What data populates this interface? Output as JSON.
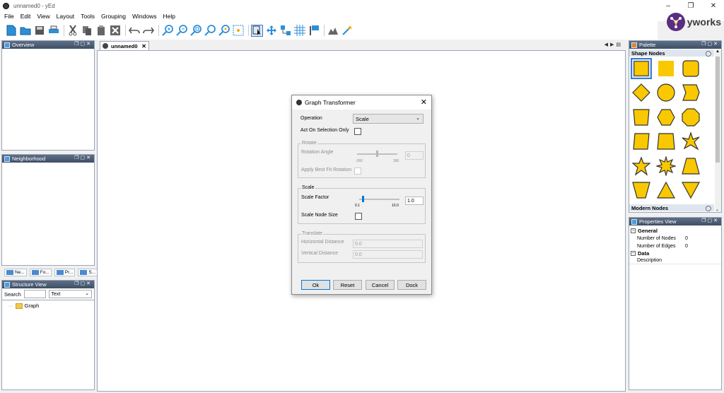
{
  "window": {
    "title": "unnamed0 - yEd"
  },
  "menu": [
    "File",
    "Edit",
    "View",
    "Layout",
    "Tools",
    "Grouping",
    "Windows",
    "Help"
  ],
  "logo": {
    "text": "yworks",
    "color": "#5a2d82"
  },
  "toolbar": {
    "icons": [
      "new-document-icon",
      "open-folder-icon",
      "save-icon",
      "print-icon",
      "cut-icon",
      "copy-icon",
      "paste-icon",
      "delete-icon",
      "undo-icon",
      "redo-icon",
      "zoom-in-icon",
      "zoom-out-icon",
      "zoom-fit-icon",
      "zoom-original-icon",
      "zoom-area-icon",
      "fit-content-icon",
      "edit-mode-icon",
      "move-mode-icon",
      "group-icon",
      "grid-icon",
      "snap-icon",
      "image-icon",
      "magic-wand-icon"
    ],
    "active": "edit-mode-icon"
  },
  "panels": {
    "overview": {
      "title": "Overview"
    },
    "neighborhood": {
      "title": "Neighborhood"
    },
    "bottom_tabs": [
      "Ne...",
      "Fo...",
      "Pr...",
      "S..."
    ],
    "structure": {
      "title": "Structure View",
      "search_label": "Search",
      "search_value": "",
      "filter": "Text",
      "tree": [
        "Graph"
      ]
    },
    "palette": {
      "title": "Palette",
      "section": "Shape Nodes",
      "section2": "Modern Nodes",
      "fill_color": "#f9c800",
      "stroke_color": "#333333"
    },
    "properties": {
      "title": "Properties View",
      "categories": [
        {
          "name": "General",
          "rows": [
            {
              "label": "Number of Nodes",
              "value": "0"
            },
            {
              "label": "Number of Edges",
              "value": "0"
            }
          ]
        },
        {
          "name": "Data",
          "rows": [
            {
              "label": "Description",
              "value": ""
            }
          ]
        }
      ]
    }
  },
  "editor": {
    "tab": "unnamed0"
  },
  "dialog": {
    "title": "Graph Transformer",
    "operation_label": "Operation",
    "operation_value": "Scale",
    "act_on_selection_label": "Act On Selection Only",
    "rotate": {
      "title": "Rotate",
      "angle_label": "Rotation Angle",
      "min": "-360",
      "max": "360",
      "angle_value": 0,
      "angle_display": "0",
      "best_fit_label": "Apply Best Fit Rotation"
    },
    "scale": {
      "title": "Scale",
      "factor_label": "Scale Factor",
      "min": "0.1",
      "max": "10.0",
      "factor_value": 1.0,
      "factor_display": "1.0",
      "node_size_label": "Scale Node Size"
    },
    "translate": {
      "title": "Translate",
      "horizontal_label": "Horizontal Distance",
      "horizontal_value": "0.0",
      "vertical_label": "Vertical Distance",
      "vertical_value": "0.0"
    },
    "buttons": {
      "ok": "Ok",
      "reset": "Reset",
      "cancel": "Cancel",
      "dock": "Dock"
    }
  }
}
